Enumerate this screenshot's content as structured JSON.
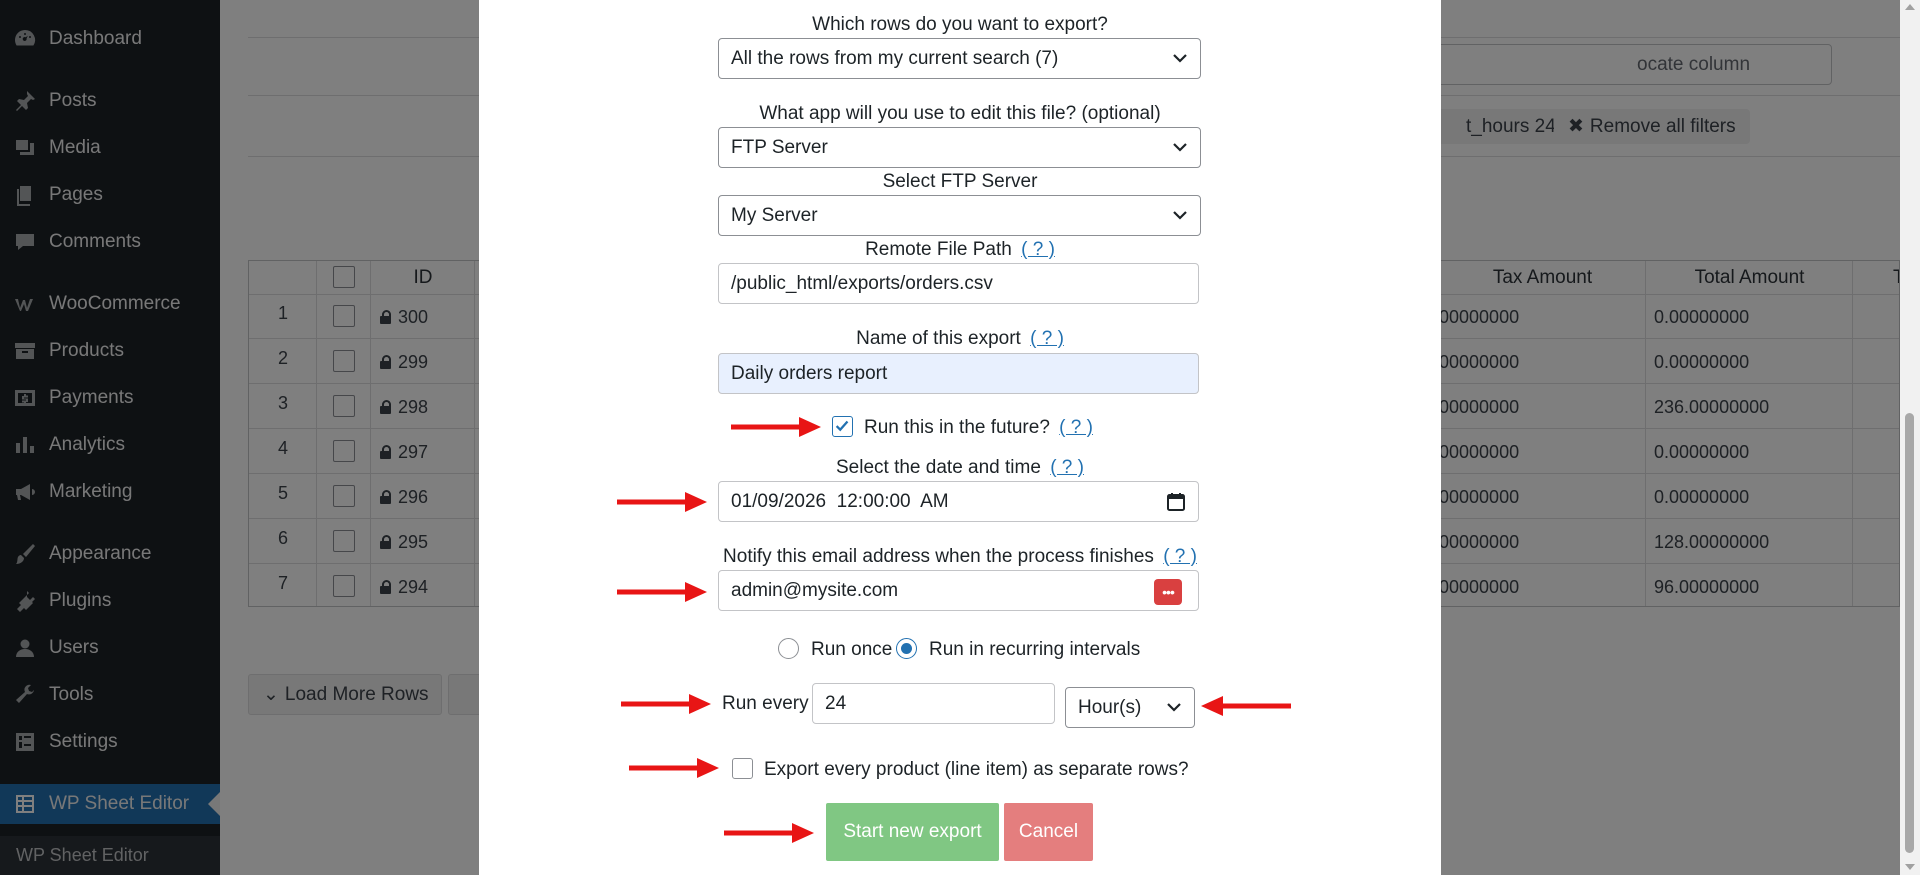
{
  "sidebar": {
    "items": [
      {
        "label": "Dashboard",
        "icon": "dashboard-icon"
      },
      {
        "label": "Posts",
        "icon": "pin-icon"
      },
      {
        "label": "Media",
        "icon": "media-icon"
      },
      {
        "label": "Pages",
        "icon": "pages-icon"
      },
      {
        "label": "Comments",
        "icon": "comment-icon"
      },
      {
        "label": "WooCommerce",
        "icon": "woocommerce-icon"
      },
      {
        "label": "Products",
        "icon": "archive-icon"
      },
      {
        "label": "Payments",
        "icon": "dollar-icon"
      },
      {
        "label": "Analytics",
        "icon": "bar-chart-icon"
      },
      {
        "label": "Marketing",
        "icon": "megaphone-icon"
      },
      {
        "label": "Appearance",
        "icon": "paintbrush-icon"
      },
      {
        "label": "Plugins",
        "icon": "plugin-icon"
      },
      {
        "label": "Users",
        "icon": "user-icon"
      },
      {
        "label": "Tools",
        "icon": "wrench-icon"
      },
      {
        "label": "Settings",
        "icon": "sliders-icon"
      },
      {
        "label": "WP Sheet Editor",
        "icon": "sheet-icon"
      }
    ],
    "submenu_label": "WP Sheet Editor",
    "active_color": "#2271b1"
  },
  "background": {
    "locate_placeholder": "ocate column",
    "filter_chip": "t_hours 24",
    "remove_filters": "Remove all filters",
    "columns": [
      "ID",
      "Tax Amount",
      "Total Amount",
      "Tra"
    ],
    "rows": [
      {
        "num": "1",
        "id": "300",
        "tax": "00000000",
        "total": "0.00000000"
      },
      {
        "num": "2",
        "id": "299",
        "tax": "00000000",
        "total": "0.00000000"
      },
      {
        "num": "3",
        "id": "298",
        "tax": "00000000",
        "total": "236.00000000"
      },
      {
        "num": "4",
        "id": "297",
        "tax": "00000000",
        "total": "0.00000000"
      },
      {
        "num": "5",
        "id": "296",
        "tax": "00000000",
        "total": "0.00000000"
      },
      {
        "num": "6",
        "id": "295",
        "tax": "00000000",
        "total": "128.00000000"
      },
      {
        "num": "7",
        "id": "294",
        "tax": "00000000",
        "total": "96.00000000"
      }
    ],
    "load_more": "Load More Rows"
  },
  "modal": {
    "rows_question": "Which rows do you want to export?",
    "rows_value": "All the rows from my current search (7)",
    "app_question": "What app will you use to edit this file? (optional)",
    "app_value": "FTP Server",
    "ftp_label": "Select FTP Server",
    "ftp_value": "My Server",
    "path_label": "Remote File Path",
    "path_value": "/public_html/exports/orders.csv",
    "name_label": "Name of this export",
    "name_value": "Daily orders report",
    "future_label": "Run this in the future?",
    "future_checked": true,
    "datetime_label": "Select the date and time",
    "datetime_value": "01/09/2026  12:00:00  AM",
    "email_label": "Notify this email address when the process finishes",
    "email_value": "admin@mysite.com",
    "run_once": "Run once",
    "run_recurring": "Run in recurring intervals",
    "recurring_selected": true,
    "run_every_label": "Run every",
    "run_every_value": "24",
    "interval_unit": "Hour(s)",
    "separate_rows_label": "Export every product (line item) as separate rows?",
    "separate_rows_checked": false,
    "help_text": "( ? )",
    "start_button": "Start new export",
    "cancel_button": "Cancel",
    "arrow_color": "#e81515"
  }
}
